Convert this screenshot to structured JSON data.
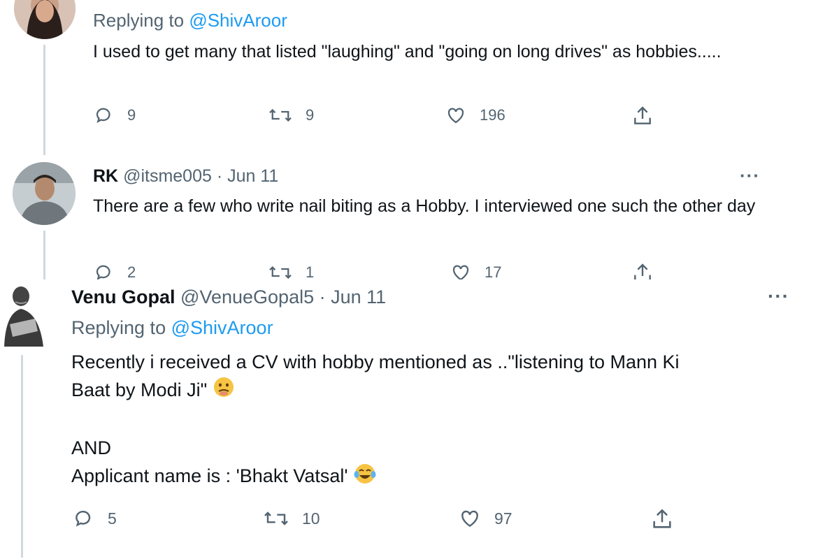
{
  "tweet1": {
    "replying_label": "Replying to",
    "replying_handle": "@ShivAroor",
    "text": "I used to get many that listed \"laughing\" and \"going on long drives\" as hobbies.....",
    "replies": "9",
    "retweets": "9",
    "likes": "196"
  },
  "tweet2": {
    "name": "RK",
    "handle_date": "@itsme005 · Jun 11",
    "text": "There are a few who write nail biting as a Hobby. I interviewed one such the other day",
    "replies": "2",
    "retweets": "1",
    "likes": "17",
    "more": "···"
  },
  "tweet3": {
    "name": "Venu Gopal",
    "handle_date": "@VenueGopal5 · Jun 11",
    "replying_label": "Replying to",
    "replying_handle": "@ShivAroor",
    "line1": "Recently i received a CV with hobby mentioned as ..\"listening to Mann Ki",
    "line2": "Baat by Modi Ji\"",
    "line3": "AND",
    "line4": "Applicant name is : 'Bhakt Vatsal'",
    "replies": "5",
    "retweets": "10",
    "likes": "97",
    "more": "···"
  },
  "colors": {
    "link": "#1d9bf0",
    "muted": "#536471",
    "text": "#0f1419",
    "thread_line": "#cfd9de"
  },
  "icons": [
    "reply-icon",
    "retweet-icon",
    "like-icon",
    "share-icon",
    "more-icon"
  ]
}
